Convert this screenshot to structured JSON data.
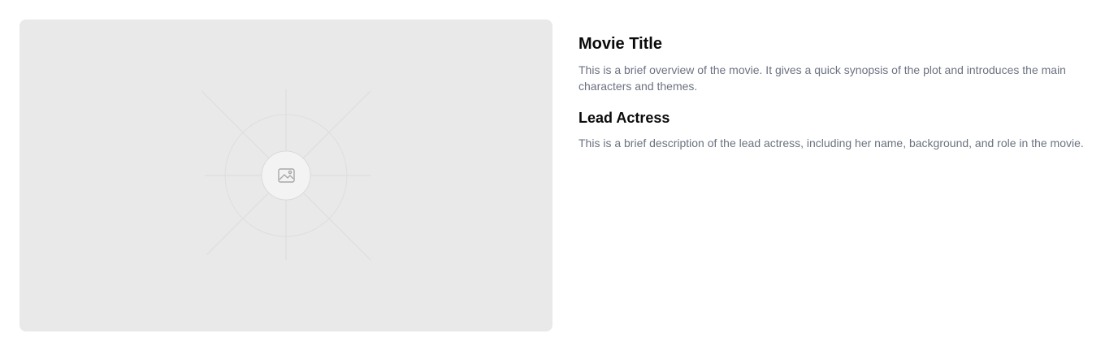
{
  "media": {
    "placeholder_icon": "image-icon",
    "background_color": "#e9e9e9"
  },
  "movie": {
    "title": "Movie Title",
    "overview": "This is a brief overview of the movie. It gives a quick synopsis of the plot and introduces the main characters and themes."
  },
  "actress": {
    "heading": "Lead Actress",
    "description": "This is a brief description of the lead actress, including her name, background, and role in the movie."
  },
  "colors": {
    "heading": "#0a0a0a",
    "body_text": "#6b7280"
  }
}
